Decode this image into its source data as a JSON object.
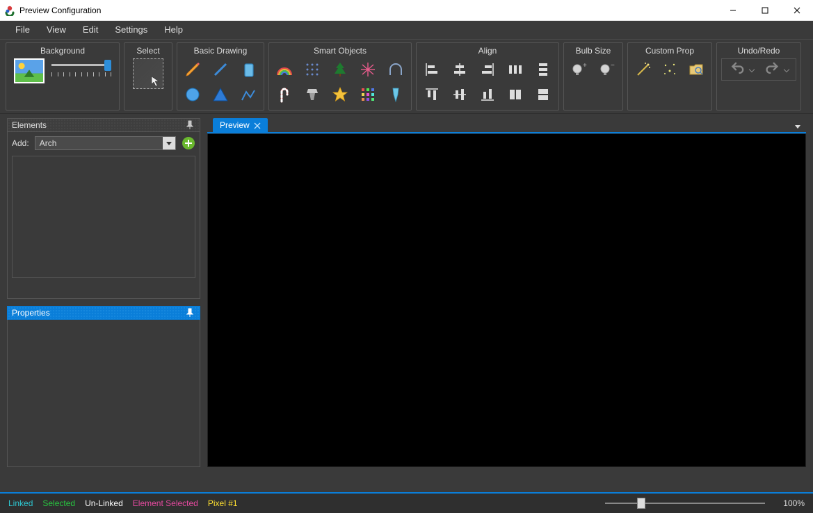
{
  "window": {
    "title": "Preview Configuration"
  },
  "menu": {
    "items": [
      "File",
      "View",
      "Edit",
      "Settings",
      "Help"
    ]
  },
  "ribbon": {
    "groups": {
      "background": {
        "label": "Background"
      },
      "select": {
        "label": "Select"
      },
      "basic": {
        "label": "Basic Drawing"
      },
      "smart": {
        "label": "Smart Objects"
      },
      "align": {
        "label": "Align"
      },
      "bulbsize": {
        "label": "Bulb Size"
      },
      "customprop": {
        "label": "Custom Prop"
      },
      "undoredo": {
        "label": "Undo/Redo"
      }
    }
  },
  "elements_panel": {
    "title": "Elements",
    "add_label": "Add:",
    "add_value": "Arch"
  },
  "properties_panel": {
    "title": "Properties"
  },
  "preview_tab": {
    "label": "Preview"
  },
  "statusbar": {
    "linked": "Linked",
    "selected": "Selected",
    "unlinked": "Un-Linked",
    "element_selected": "Element Selected",
    "pixel": "Pixel #1",
    "zoom": "100%"
  },
  "colors": {
    "accent": "#0a7ed9",
    "linked": "#2ec6d0",
    "selected": "#28c740",
    "unlinked": "#ffffff",
    "element_selected": "#e64aa0",
    "pixel": "#ffe030"
  }
}
